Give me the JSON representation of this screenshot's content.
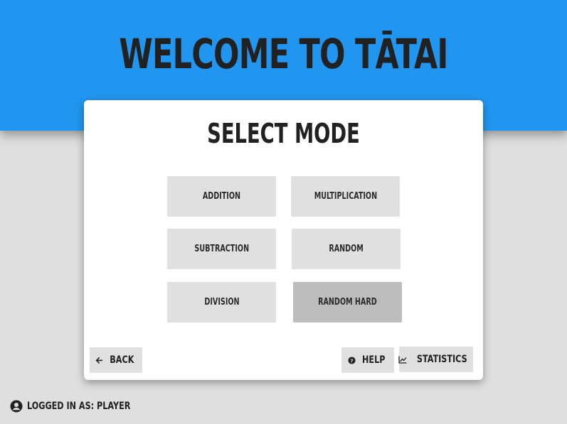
{
  "header": {
    "title": "WELCOME TO TĀTAI"
  },
  "card": {
    "title": "SELECT MODE",
    "modes": [
      {
        "label": "ADDITION",
        "selected": false
      },
      {
        "label": "MULTIPLICATION",
        "selected": false
      },
      {
        "label": "SUBTRACTION",
        "selected": false
      },
      {
        "label": "RANDOM",
        "selected": false
      },
      {
        "label": "DIVISION",
        "selected": false
      },
      {
        "label": "RANDOM HARD",
        "selected": true
      }
    ],
    "back_label": "BACK",
    "back_icon": "arrow-left-icon",
    "help_label": "HELP",
    "help_icon": "question-circle-icon",
    "statistics_label": "STATISTICS",
    "statistics_icon": "line-chart-icon"
  },
  "status": {
    "icon": "user-circle-icon",
    "logged_in_text": "LOGGED IN AS: PLAYER"
  },
  "colors": {
    "header_bg": "#2196f0",
    "page_bg": "#dfdfdf",
    "button_bg": "#e0e0e0",
    "button_selected_bg": "#bdbdbd",
    "text": "#212121"
  }
}
